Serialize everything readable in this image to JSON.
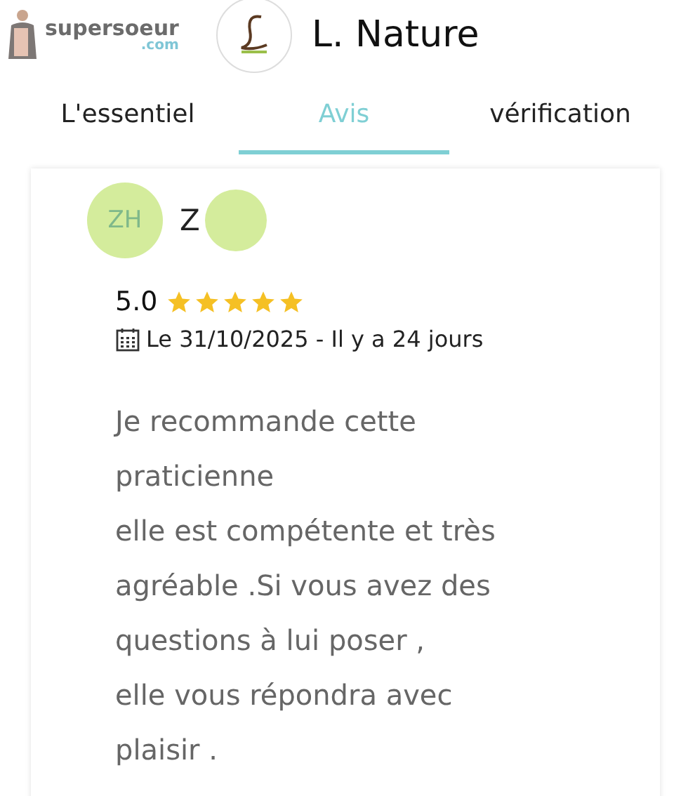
{
  "header": {
    "site_logo": {
      "name": "supersoeur",
      "domain": ".com"
    },
    "title": "L. Nature"
  },
  "tabs": [
    {
      "label": "L'essentiel",
      "selected": false
    },
    {
      "label": "Avis",
      "selected": true
    },
    {
      "label": "vérification",
      "selected": false
    }
  ],
  "review": {
    "initials": "ZH",
    "name": "Z",
    "rating": "5.0",
    "stars": 5,
    "date": "Le 31/10/2025 - Il y a 24 jours",
    "text_lines": [
      "Je recommande cette",
      "praticienne",
      "elle est compétente et très",
      "agréable .Si vous avez des",
      "questions à lui poser ,",
      "elle vous répondra avec",
      "plaisir ."
    ]
  }
}
